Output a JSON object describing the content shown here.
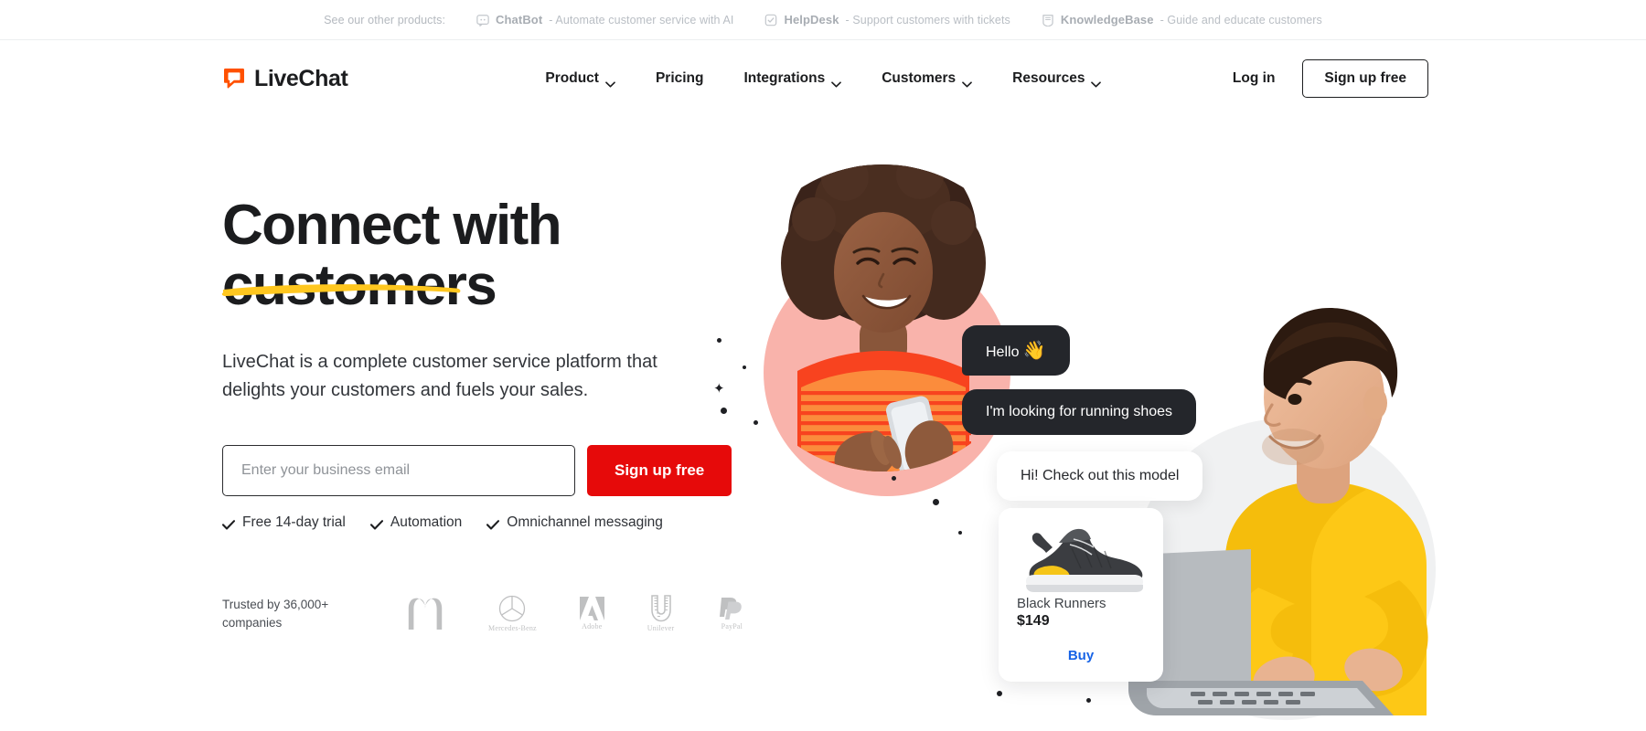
{
  "topbar": {
    "lead": "See our other products:",
    "products": [
      {
        "icon": "chatbot-icon",
        "name": "ChatBot",
        "desc": "- Automate customer service with AI"
      },
      {
        "icon": "helpdesk-icon",
        "name": "HelpDesk",
        "desc": "- Support customers with tickets"
      },
      {
        "icon": "knowledgebase-icon",
        "name": "KnowledgeBase",
        "desc": "- Guide and educate customers"
      }
    ]
  },
  "nav": {
    "logo_text": "LiveChat",
    "logo_icon": "livechat-bubble-icon",
    "items": [
      {
        "label": "Product",
        "has_caret": true
      },
      {
        "label": "Pricing",
        "has_caret": false
      },
      {
        "label": "Integrations",
        "has_caret": true
      },
      {
        "label": "Customers",
        "has_caret": true
      },
      {
        "label": "Resources",
        "has_caret": true
      }
    ],
    "login_label": "Log in",
    "signup_label": "Sign up free"
  },
  "hero": {
    "headline_line1": "Connect with",
    "headline_line2": "customers",
    "subheading": "LiveChat is a complete customer service platform that delights your customers and fuels your sales.",
    "email_placeholder": "Enter your business email",
    "email_value": "",
    "cta_label": "Sign up free",
    "features": [
      "Free 14-day trial",
      "Automation",
      "Omnichannel messaging"
    ],
    "trusted_text": "Trusted by 36,000+ companies",
    "brands": [
      "McDonald's",
      "Mercedes-Benz",
      "Adobe",
      "Unilever",
      "PayPal"
    ]
  },
  "chat": {
    "messages": [
      {
        "text": "Hello",
        "emoji": "👋",
        "style": "dark"
      },
      {
        "text": "I'm looking for running shoes",
        "style": "dark"
      },
      {
        "text": "Hi! Check out this model",
        "style": "light"
      }
    ],
    "product_card": {
      "image": "black-running-shoe",
      "name": "Black Runners",
      "price": "$149",
      "buy_label": "Buy"
    }
  },
  "colors": {
    "brand_orange": "#ff5100",
    "cta_red": "#e60a0a",
    "underline_yellow": "#ffc71f",
    "bubble_dark": "#24262b",
    "buy_blue": "#1763e6",
    "blob_pink": "#f9b3ab",
    "blob_gray": "#f0f1f2"
  }
}
